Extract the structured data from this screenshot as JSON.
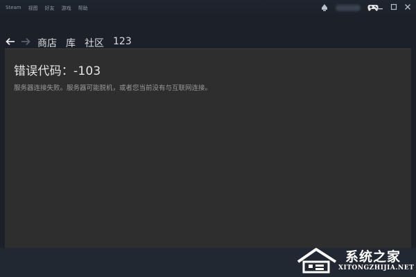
{
  "menu": {
    "items": [
      "Steam",
      "视图",
      "好友",
      "游戏",
      "帮助"
    ]
  },
  "nav": {
    "links": [
      "商店",
      "库",
      "社区",
      "123"
    ]
  },
  "error": {
    "title": "错误代码：-103",
    "message": "服务器连接失败。服务器可能脱机，或者您当前没有与互联网连接。"
  },
  "watermark": {
    "title": "系统之家",
    "url": "XITONGZHIJIA.NET"
  },
  "icons": {
    "back": "arrow-left-icon",
    "forward": "arrow-right-icon",
    "notification": "bell-icon",
    "controller": "gamepad-icon",
    "minimize": "minimize-icon",
    "maximize": "maximize-icon",
    "close": "close-icon"
  },
  "colors": {
    "background": "#1b2029",
    "panel": "#2e2e2e",
    "text": "#dcdedf"
  }
}
